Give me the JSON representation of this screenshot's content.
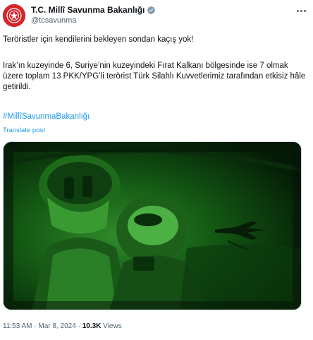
{
  "account": {
    "display_name": "T.C. Millî Savunma Bakanlığı",
    "handle": "@tcsavunma",
    "avatar_icon": "ministry-emblem-icon",
    "verified_icon": "verified-badge-icon",
    "verified_color": "#829aab"
  },
  "post": {
    "line1": "Teröristler için kendilerini bekleyen sondan kaçış yok!",
    "line2": "Irak’ın kuzeyinde 6, Suriye’nin kuzeyindeki Fırat Kalkanı bölgesinde ise 7 olmak üzere toplam 13 PKK/YPG’li terörist Türk Silahlı Kuvvetlerimiz tarafından etkisiz hâle getirildi.",
    "hashtag": "#MillîSavunmaBakanlığı",
    "translate_label": "Translate post"
  },
  "meta": {
    "time": "11:53 AM",
    "separator": "·",
    "date": "Mar 8, 2024",
    "views_count": "10.3K",
    "views_label": "Views"
  },
  "colors": {
    "link": "#1d9bf0",
    "secondary_text": "#536471",
    "night_vision_green": "#3fae3a"
  }
}
